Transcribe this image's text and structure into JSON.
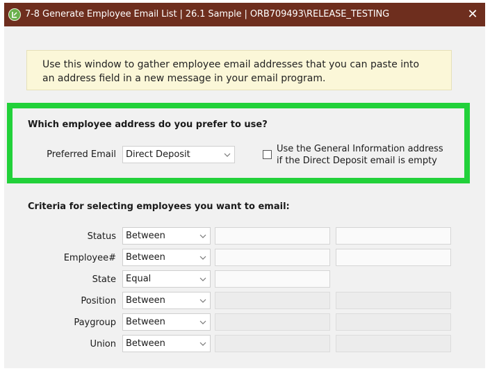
{
  "window": {
    "title": "7-8 Generate Employee Email List | 26.1 Sample | ORB709493\\RELEASE_TESTING",
    "close_glyph": "✕"
  },
  "info": {
    "text": "Use this window to gather employee email addresses that you can paste into an address field in a new message in your email program."
  },
  "address_section": {
    "title": "Which employee address do you prefer to use?",
    "preferred_label": "Preferred Email",
    "preferred_value": "Direct Deposit",
    "checkbox_label_line1": "Use the General Information address",
    "checkbox_label_line2": "if the Direct Deposit email is empty",
    "checkbox_checked": false
  },
  "criteria": {
    "title": "Criteria for selecting employees you want to email:",
    "rows": [
      {
        "label": "Status",
        "operator": "Between"
      },
      {
        "label": "Employee#",
        "operator": "Between"
      },
      {
        "label": "State",
        "operator": "Equal"
      },
      {
        "label": "Position",
        "operator": "Between"
      },
      {
        "label": "Paygroup",
        "operator": "Between"
      },
      {
        "label": "Union",
        "operator": "Between"
      }
    ]
  },
  "colors": {
    "titlebar": "#6e2e1e",
    "highlight": "#22d13a",
    "info_bg": "#fbf7d8"
  }
}
